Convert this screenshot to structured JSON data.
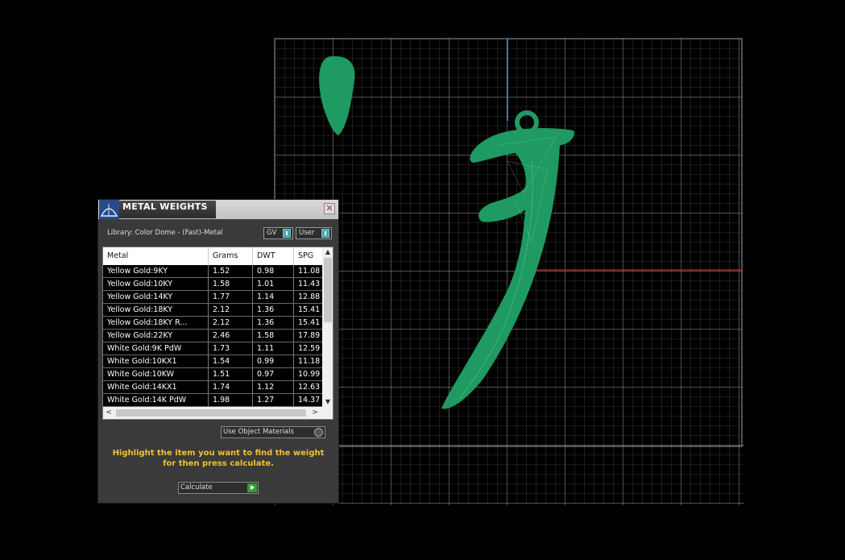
{
  "panel": {
    "title": "METAL WEIGHTS",
    "library_label": "Library: Color Dome - (Fast)-Metal",
    "gv_label": "GV",
    "user_label": "User",
    "columns": [
      "Metal",
      "Grams",
      "DWT",
      "SPG"
    ],
    "rows": [
      [
        "Yellow Gold:9KY",
        "1.52",
        "0.98",
        "11.08"
      ],
      [
        "Yellow Gold:10KY",
        "1.58",
        "1.01",
        "11.43"
      ],
      [
        "Yellow Gold:14KY",
        "1.77",
        "1.14",
        "12.88"
      ],
      [
        "Yellow Gold:18KY",
        "2.12",
        "1.36",
        "15.41"
      ],
      [
        "Yellow Gold:18KY R...",
        "2.12",
        "1.36",
        "15.41"
      ],
      [
        "Yellow Gold:22KY",
        "2.46",
        "1.58",
        "17.89"
      ],
      [
        "White Gold:9K PdW",
        "1.73",
        "1.11",
        "12.59"
      ],
      [
        "White Gold:10KX1",
        "1.54",
        "0.99",
        "11.18"
      ],
      [
        "White Gold:10KW",
        "1.51",
        "0.97",
        "10.99"
      ],
      [
        "White Gold:14KX1",
        "1.74",
        "1.12",
        "12.63"
      ],
      [
        "White Gold:14K PdW",
        "1.98",
        "1.27",
        "14.37"
      ]
    ],
    "use_object_materials_label": "Use Object Materials",
    "instruction": "Highlight the item you want to find the weight for then press calculate.",
    "calculate_label": "Calculate"
  },
  "colors": {
    "model": "#1f9a62",
    "grid": "#8a8a8a",
    "axis_x": "#b31a1a",
    "axis_y": "#2a8fa6",
    "instruction": "#f0c030"
  },
  "icons": {
    "title_logo": "dome-logo-icon",
    "close": "close-icon"
  }
}
